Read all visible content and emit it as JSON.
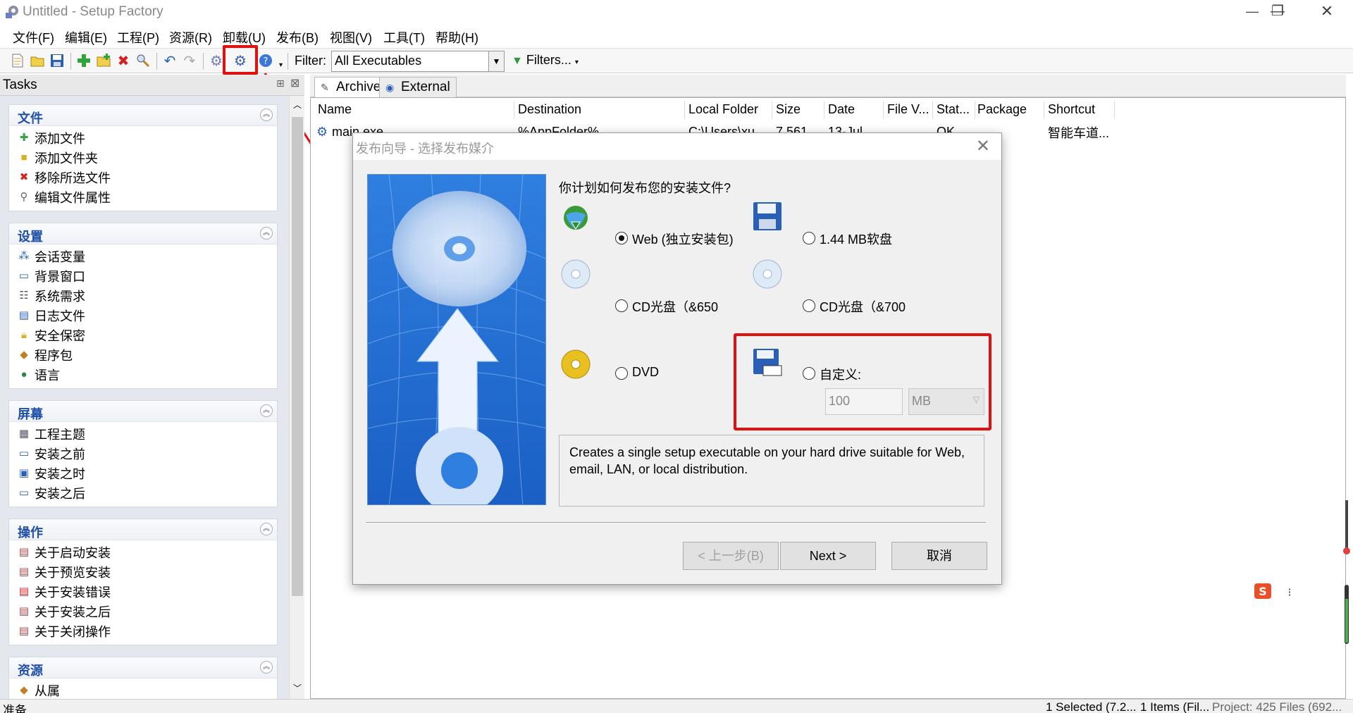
{
  "window": {
    "title": "Untitled - Setup Factory",
    "minimize": "—",
    "restore": "❐",
    "close": "✕"
  },
  "menu": [
    "文件(F)",
    "编辑(E)",
    "工程(P)",
    "资源(R)",
    "卸载(U)",
    "发布(B)",
    "视图(V)",
    "工具(T)",
    "帮助(H)"
  ],
  "toolbar": {
    "filter_label": "Filter:",
    "filter_value": "All Executables",
    "filters_button": "Filters..."
  },
  "tasks": {
    "title": "Tasks",
    "groups": [
      {
        "title": "文件",
        "items": [
          "添加文件",
          "添加文件夹",
          "移除所选文件",
          "编辑文件属性"
        ]
      },
      {
        "title": "设置",
        "items": [
          "会话变量",
          "背景窗口",
          "系统需求",
          "日志文件",
          "安全保密",
          "程序包",
          "语言"
        ]
      },
      {
        "title": "屏幕",
        "items": [
          "工程主题",
          "安装之前",
          "安装之时",
          "安装之后"
        ]
      },
      {
        "title": "操作",
        "items": [
          "关于启动安装",
          "关于预览安装",
          "关于安装错误",
          "关于安装之后",
          "关于关闭操作"
        ]
      },
      {
        "title": "资源",
        "items": [
          "从属"
        ]
      }
    ]
  },
  "tabs": [
    "Archive",
    "External"
  ],
  "list": {
    "columns": [
      "Name",
      "Destination",
      "Local Folder",
      "Size",
      "Date",
      "File V...",
      "Stat...",
      "Package",
      "Shortcut"
    ],
    "rows": [
      [
        "main.exe",
        "%AppFolder%",
        "C:\\Users\\xu...",
        "7,561...",
        "13-Jul...",
        "",
        "OK",
        "",
        "智能车道..."
      ]
    ]
  },
  "statusbar": {
    "left": "准备",
    "selected": "1 Selected (7.2...",
    "items": "1 Items (Fil...",
    "project": "Project: 425 Files (692..."
  },
  "dialog": {
    "title": "发布向导 - 选择发布媒介",
    "question": "你计划如何发布您的安装文件?",
    "options": [
      {
        "label": "Web (独立安装包)",
        "selected": true,
        "icon": "globe-download-icon"
      },
      {
        "label": "1.44 MB软盘",
        "selected": false,
        "icon": "floppy-disk-icon"
      },
      {
        "label": "CD光盘（&650",
        "selected": false,
        "icon": "cd-icon"
      },
      {
        "label": "CD光盘（&700",
        "selected": false,
        "icon": "cd-icon"
      },
      {
        "label": "DVD",
        "selected": false,
        "icon": "dvd-icon"
      },
      {
        "label": "自定义:",
        "selected": false,
        "icon": "custom-disk-icon"
      }
    ],
    "custom_size": "100",
    "custom_unit": "MB",
    "description": "Creates a single setup executable on your hard drive suitable for Web, email, LAN, or local distribution.",
    "back_button": "< 上一步(B)",
    "next_button": "Next >",
    "cancel_button": "取消"
  },
  "colors": {
    "annotation_red": "#e01010",
    "group_title": "#1f4fa8"
  }
}
